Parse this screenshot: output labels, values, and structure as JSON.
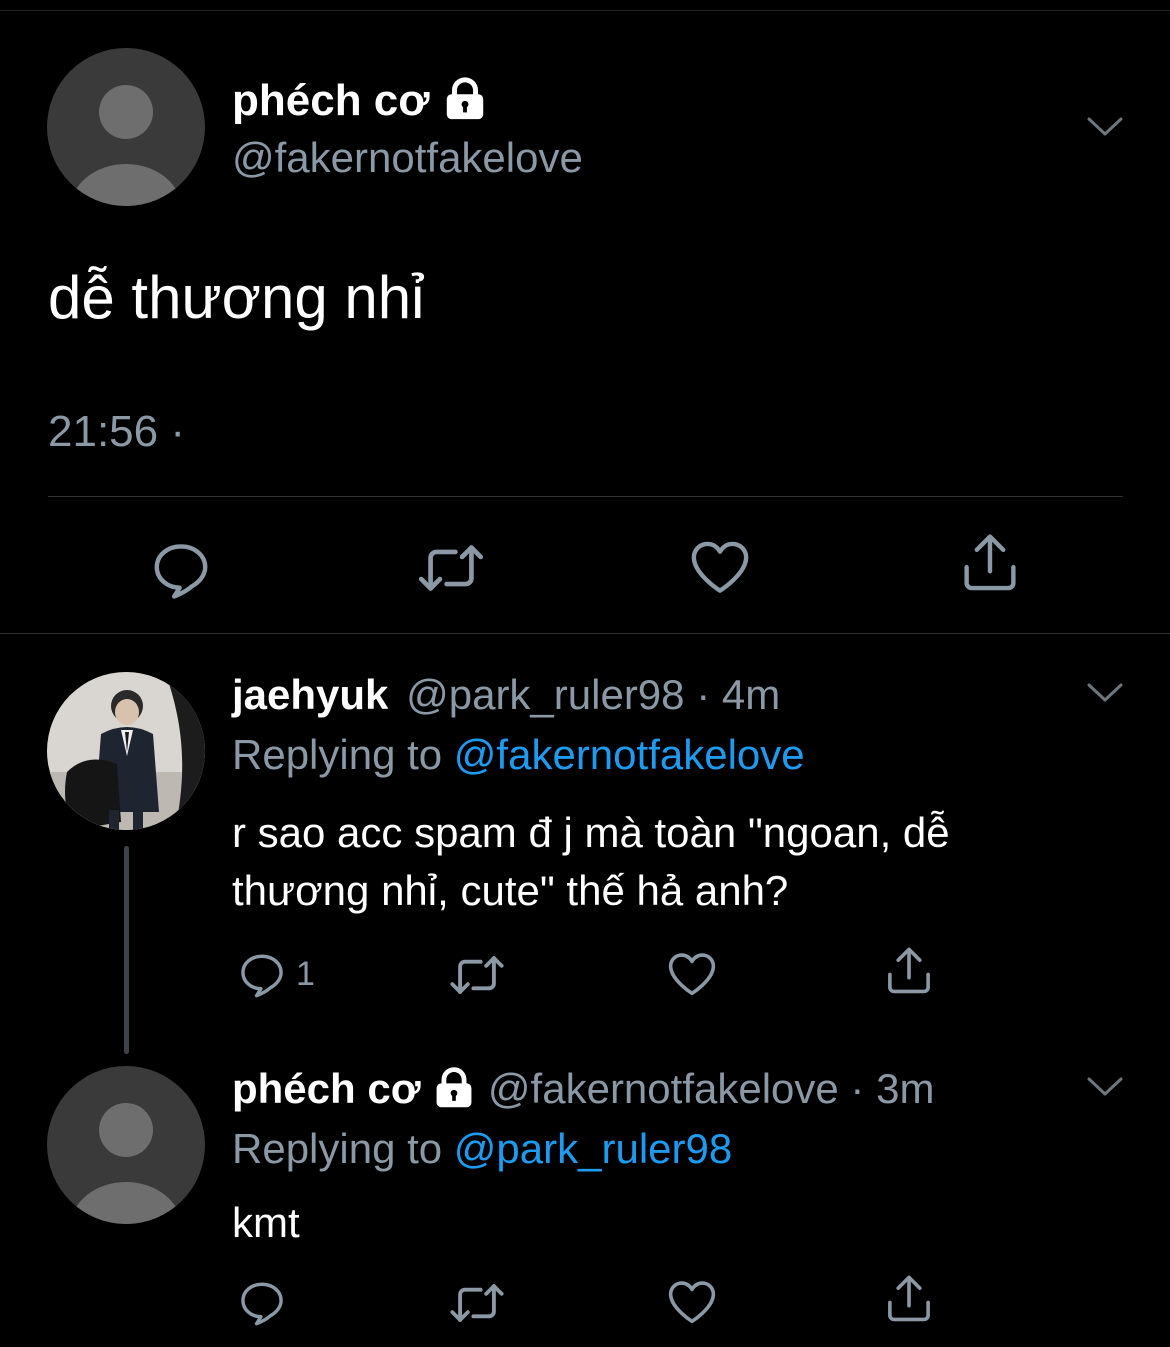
{
  "main_tweet": {
    "display_name": "phéch cơ",
    "handle": "@fakernotfakelove",
    "text": "dễ thương nhỉ",
    "timestamp": "21:56",
    "separator": "·",
    "icons": [
      "reply-icon",
      "retweet-icon",
      "like-icon",
      "share-icon"
    ]
  },
  "replies": [
    {
      "display_name": "jaehyuk",
      "handle": "@park_ruler98",
      "dot": "·",
      "time": "4m",
      "replying_prefix": "Replying to",
      "replying_handle": "@fakernotfakelove",
      "text_line1": "r sao acc spam đ j mà toàn \"ngoan, dễ",
      "text_line2": "thương nhỉ, cute\" thế hả anh?",
      "reply_count": "1"
    },
    {
      "display_name": "phéch cơ",
      "handle": "@fakernotfakelove",
      "dot": "·",
      "time": "3m",
      "replying_prefix": "Replying to",
      "replying_handle": "@park_ruler98",
      "text": "kmt"
    }
  ],
  "colors": {
    "background": "#000000",
    "text": "#ffffff",
    "muted": "#8b98a5",
    "link": "#1d9bf0",
    "divider": "#2f3336"
  }
}
